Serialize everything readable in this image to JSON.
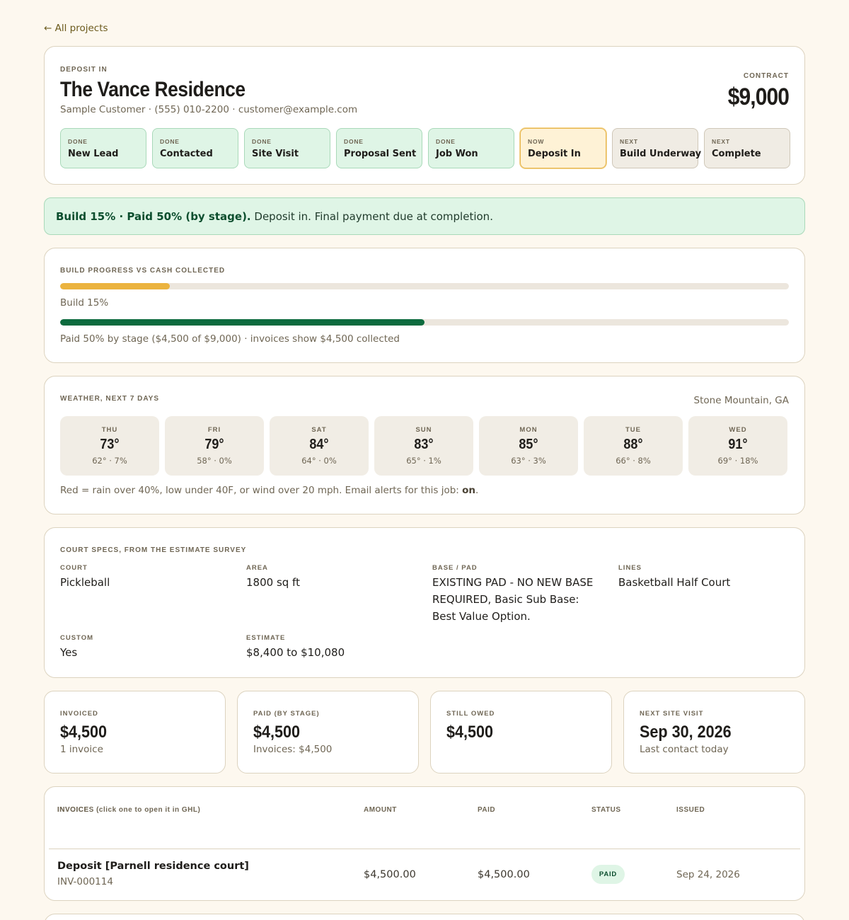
{
  "nav": {
    "back_label": "← All projects"
  },
  "project": {
    "status_label": "DEPOSIT IN",
    "title": "The Vance Residence",
    "subtitle": "Sample Customer · (555) 010-2200 · customer@example.com",
    "contract_label": "CONTRACT",
    "contract_value": "$9,000"
  },
  "stages": [
    {
      "tag": "DONE",
      "name": "New Lead",
      "state": "done"
    },
    {
      "tag": "DONE",
      "name": "Contacted",
      "state": "done"
    },
    {
      "tag": "DONE",
      "name": "Site Visit",
      "state": "done"
    },
    {
      "tag": "DONE",
      "name": "Proposal Sent",
      "state": "done"
    },
    {
      "tag": "DONE",
      "name": "Job Won",
      "state": "done"
    },
    {
      "tag": "NOW",
      "name": "Deposit In",
      "state": "now"
    },
    {
      "tag": "NEXT",
      "name": "Build Underway",
      "state": "next"
    },
    {
      "tag": "NEXT",
      "name": "Complete",
      "state": "next"
    }
  ],
  "banner": {
    "bold": "Build 15% · Paid 50% (by stage).",
    "text": " Deposit in. Final payment due at completion."
  },
  "progress": {
    "label": "BUILD PROGRESS VS CASH COLLECTED",
    "build_percent": 15,
    "build_caption": "Build 15%",
    "paid_percent": 50,
    "paid_caption": "Paid 50% by stage ($4,500 of $9,000) · invoices show $4,500 collected",
    "colors": {
      "build": "#ebb33f",
      "paid": "#0d6b3e"
    }
  },
  "weather": {
    "label": "WEATHER, NEXT 7 DAYS",
    "location": "Stone Mountain, GA",
    "days": [
      {
        "day": "THU",
        "high": "73°",
        "detail": "62° · 7%"
      },
      {
        "day": "FRI",
        "high": "79°",
        "detail": "58° · 0%"
      },
      {
        "day": "SAT",
        "high": "84°",
        "detail": "64° · 0%"
      },
      {
        "day": "SUN",
        "high": "83°",
        "detail": "65° · 1%"
      },
      {
        "day": "MON",
        "high": "85°",
        "detail": "63° · 3%"
      },
      {
        "day": "TUE",
        "high": "88°",
        "detail": "66° · 8%"
      },
      {
        "day": "WED",
        "high": "91°",
        "detail": "69° · 18%"
      }
    ],
    "note_prefix": "Red = rain over 40%, low under 40F, or wind over 20 mph. Email alerts for this job: ",
    "note_status": "on",
    "note_suffix": "."
  },
  "specs": {
    "label": "COURT SPECS, FROM THE ESTIMATE SURVEY",
    "court": {
      "label": "COURT",
      "value": "Pickleball"
    },
    "area": {
      "label": "AREA",
      "value": "1800 sq ft"
    },
    "base": {
      "label": "BASE / PAD",
      "value": "EXISTING PAD - NO NEW BASE REQUIRED, Basic Sub Base: Best Value Option."
    },
    "lines": {
      "label": "LINES",
      "value": "Basketball Half Court"
    },
    "custom": {
      "label": "CUSTOM",
      "value": "Yes"
    },
    "estimate": {
      "label": "ESTIMATE",
      "value": "$8,400 to $10,080"
    }
  },
  "stats": {
    "invoiced": {
      "label": "INVOICED",
      "value": "$4,500",
      "sub": "1 invoice"
    },
    "paid": {
      "label": "PAID (BY STAGE)",
      "value": "$4,500",
      "sub": "Invoices: $4,500"
    },
    "owed": {
      "label": "STILL OWED",
      "value": "$4,500",
      "sub": ""
    },
    "visit": {
      "label": "NEXT SITE VISIT",
      "value": "Sep 30, 2026",
      "sub": "Last contact today"
    }
  },
  "invoices": {
    "label": "INVOICES (click one to open it in GHL)",
    "columns": {
      "invoice": "INVOICE",
      "amount": "AMOUNT",
      "paid": "PAID",
      "status": "STATUS",
      "issued": "ISSUED"
    },
    "rows": [
      {
        "name": "Deposit [Parnell residence court]",
        "number": "INV-000114",
        "amount": "$4,500.00",
        "paid": "$4,500.00",
        "status": "PAID",
        "issued": "Sep 24, 2026"
      }
    ]
  }
}
